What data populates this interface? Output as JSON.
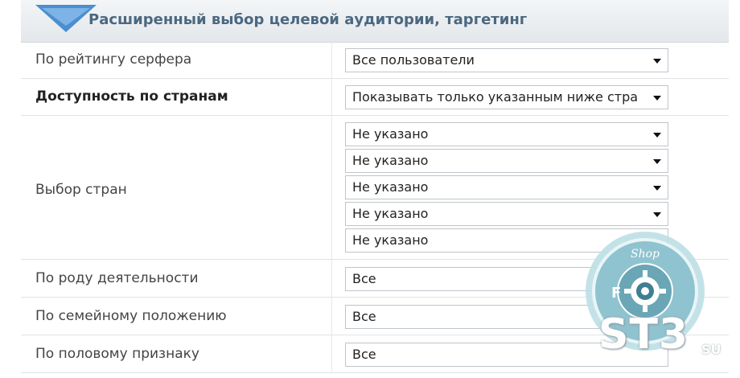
{
  "header": {
    "title": "Расширенный выбор целевой аудитории, таргетинг"
  },
  "rows": {
    "rating": {
      "label": "По рейтингу серфера",
      "value": "Все пользователи"
    },
    "countries": {
      "label": "Доступность по странам",
      "value": "Показывать только указанным ниже стра"
    },
    "country_select": {
      "label": "Выбор стран",
      "values": [
        "Не указано",
        "Не указано",
        "Не указано",
        "Не указано",
        "Не указано"
      ]
    },
    "activity": {
      "label": "По роду деятельности",
      "value": "Все"
    },
    "family": {
      "label": "По семейному положению",
      "value": "Все"
    },
    "gender": {
      "label": "По половому признаку",
      "value": "Все"
    }
  },
  "watermark": {
    "badge_top": "Shop",
    "letters": "F",
    "brand": "ST3",
    "suffix": "SU"
  },
  "colors": {
    "accent": "#4a8fd0",
    "header_text": "#4b6880",
    "badge": "#7fb6c2"
  }
}
